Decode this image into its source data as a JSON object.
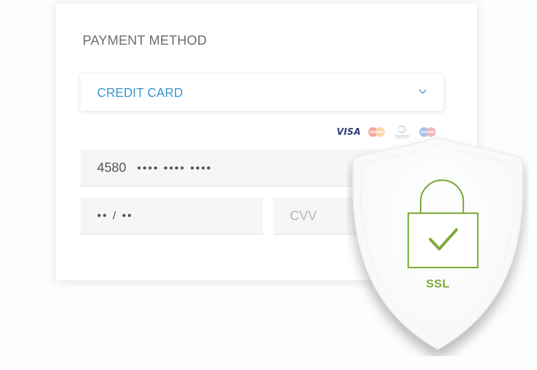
{
  "payment": {
    "title": "PAYMENT METHOD",
    "method_select": {
      "value": "CREDIT CARD"
    },
    "card_brands": [
      "visa-icon",
      "mastercard-icon",
      "diners-club-icon",
      "maestro-icon"
    ],
    "visa_label": "VISA",
    "card_number": {
      "prefix": "4580",
      "masked": "•••• •••• ••••"
    },
    "expiry": {
      "value": "•• / ••"
    },
    "cvv": {
      "placeholder": "CVV"
    }
  },
  "security_badge": {
    "label": "SSL",
    "icon": "padlock-check-icon"
  },
  "colors": {
    "accent_blue": "#3d96cf",
    "ssl_green": "#7cab3a",
    "title_grey": "#6c6c6c"
  }
}
